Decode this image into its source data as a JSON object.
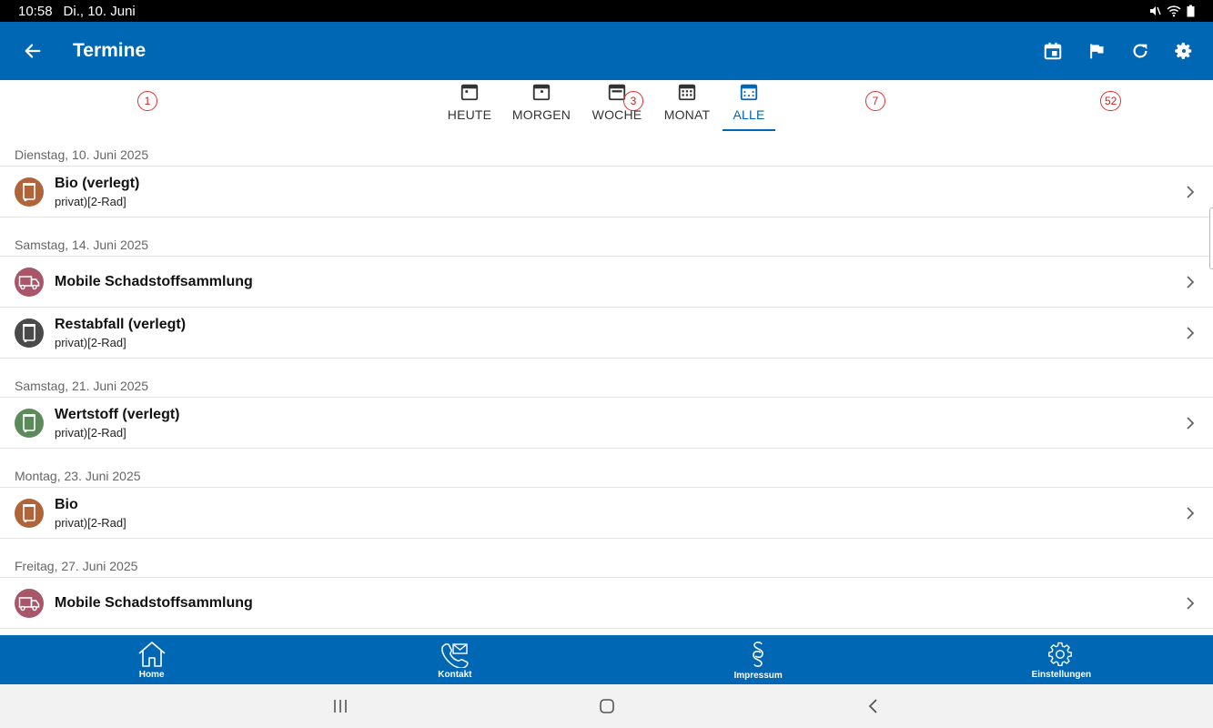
{
  "status_bar": {
    "time": "10:58",
    "date": "Di., 10. Juni"
  },
  "app_bar": {
    "title": "Termine",
    "actions": [
      "calendar-icon",
      "flag-icon",
      "refresh-icon",
      "settings-icon"
    ]
  },
  "tabs": [
    {
      "label": "HEUTE",
      "badge": "1",
      "active": false
    },
    {
      "label": "MORGEN",
      "badge": "",
      "active": false
    },
    {
      "label": "WOCHE",
      "badge": "3",
      "active": false
    },
    {
      "label": "MONAT",
      "badge": "7",
      "active": false
    },
    {
      "label": "ALLE",
      "badge": "52",
      "active": true
    }
  ],
  "sections": [
    {
      "date": "Dienstag, 10. Juni 2025",
      "items": [
        {
          "title": "Bio (verlegt)",
          "subtitle": "privat)[2-Rad]",
          "icon": "bin-icon",
          "color": "#b0643a"
        }
      ]
    },
    {
      "date": "Samstag, 14. Juni 2025",
      "items": [
        {
          "title": "Mobile Schadstoffsammlung",
          "subtitle": "",
          "icon": "truck-icon",
          "color": "#a8566a"
        },
        {
          "title": "Restabfall (verlegt)",
          "subtitle": "privat)[2-Rad]",
          "icon": "bin-icon",
          "color": "#4a4a4a"
        }
      ]
    },
    {
      "date": "Samstag, 21. Juni 2025",
      "items": [
        {
          "title": "Wertstoff (verlegt)",
          "subtitle": "privat)[2-Rad]",
          "icon": "bin-icon",
          "color": "#5c8a5a"
        }
      ]
    },
    {
      "date": "Montag, 23. Juni 2025",
      "items": [
        {
          "title": "Bio",
          "subtitle": "privat)[2-Rad]",
          "icon": "bin-icon",
          "color": "#b0643a"
        }
      ]
    },
    {
      "date": "Freitag, 27. Juni 2025",
      "items": [
        {
          "title": "Mobile Schadstoffsammlung",
          "subtitle": "",
          "icon": "truck-icon",
          "color": "#a8566a"
        }
      ]
    }
  ],
  "bottom_nav": [
    {
      "label": "Home",
      "icon": "home-icon"
    },
    {
      "label": "Kontakt",
      "icon": "phone-icon"
    },
    {
      "label": "Impressum",
      "icon": "paragraph-icon"
    },
    {
      "label": "Einstellungen",
      "icon": "gear-icon"
    }
  ],
  "colors": {
    "primary": "#0067b5",
    "badge": "#e03030"
  }
}
